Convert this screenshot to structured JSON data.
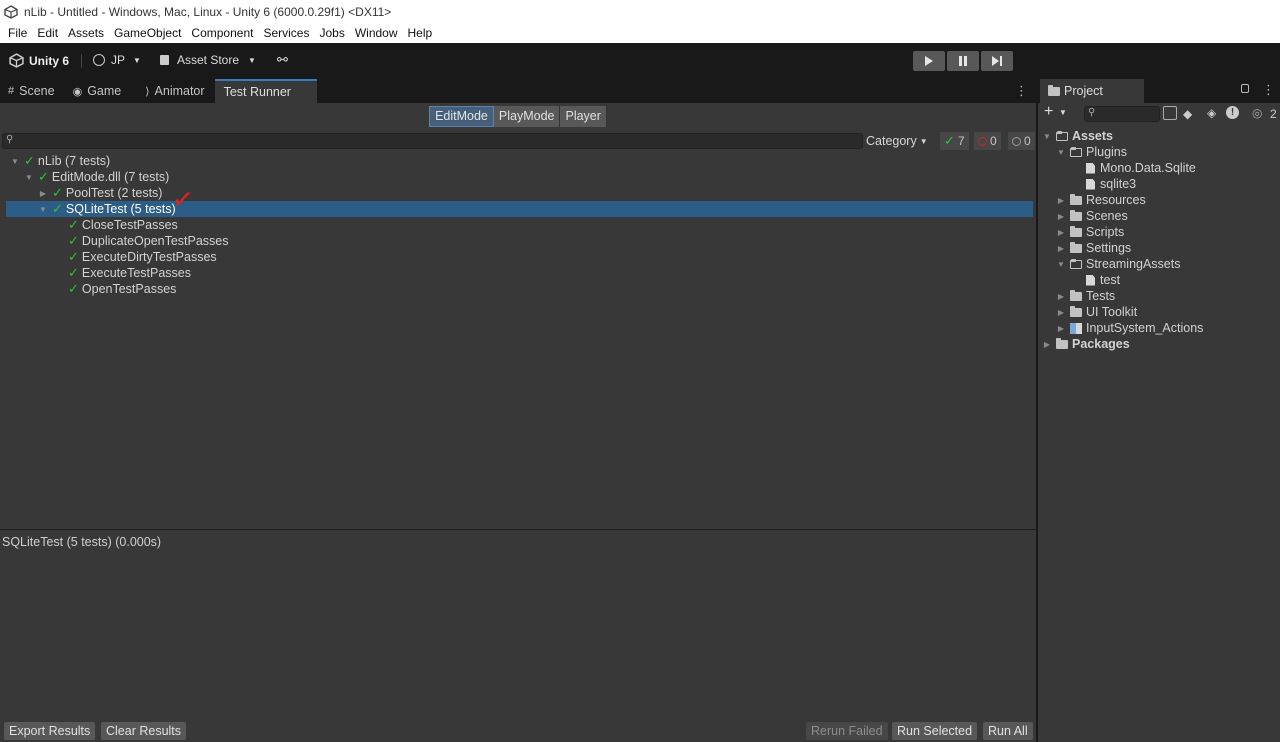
{
  "window": {
    "title": "nLib - Untitled - Windows, Mac, Linux - Unity 6 (6000.0.29f1) <DX11>"
  },
  "menu": [
    "File",
    "Edit",
    "Assets",
    "GameObject",
    "Component",
    "Services",
    "Jobs",
    "Window",
    "Help"
  ],
  "toolbar": {
    "unity_label": "Unity 6",
    "account_label": "JP",
    "asset_store_label": "Asset Store"
  },
  "tabs": [
    "Scene",
    "Game",
    "Animator",
    "Test Runner"
  ],
  "test_runner": {
    "modes": [
      "EditMode",
      "PlayMode",
      "Player"
    ],
    "selected_mode": "EditMode",
    "category_label": "Category",
    "counts": {
      "passed": "7",
      "failed": "0",
      "skipped": "0"
    },
    "tree": [
      {
        "label": "nLib (7 tests)"
      },
      {
        "label": "EditMode.dll (7 tests)"
      },
      {
        "label": "PoolTest (2 tests)"
      },
      {
        "label": "SQLiteTest (5 tests)"
      },
      {
        "label": "CloseTestPasses"
      },
      {
        "label": "DuplicateOpenTestPasses"
      },
      {
        "label": "ExecuteDirtyTestPasses"
      },
      {
        "label": "ExecuteTestPasses"
      },
      {
        "label": "OpenTestPasses"
      }
    ],
    "details": "SQLiteTest (5 tests) (0.000s)",
    "buttons": {
      "export": "Export Results",
      "clear": "Clear Results",
      "rerun_failed": "Rerun Failed",
      "run_selected": "Run Selected",
      "run_all": "Run All"
    }
  },
  "project": {
    "tab_label": "Project",
    "hidden_count": "2",
    "tree": [
      {
        "label": "Assets"
      },
      {
        "label": "Plugins"
      },
      {
        "label": "Mono.Data.Sqlite"
      },
      {
        "label": "sqlite3"
      },
      {
        "label": "Resources"
      },
      {
        "label": "Scenes"
      },
      {
        "label": "Scripts"
      },
      {
        "label": "Settings"
      },
      {
        "label": "StreamingAssets"
      },
      {
        "label": "test"
      },
      {
        "label": "Tests"
      },
      {
        "label": "UI Toolkit"
      },
      {
        "label": "InputSystem_Actions"
      },
      {
        "label": "Packages"
      }
    ]
  },
  "colors": {
    "accent": "#3a79bb",
    "selection": "#2c5d87",
    "pass_green": "#28c43a",
    "fail_red": "#e0231f",
    "panel_bg": "#383838"
  }
}
